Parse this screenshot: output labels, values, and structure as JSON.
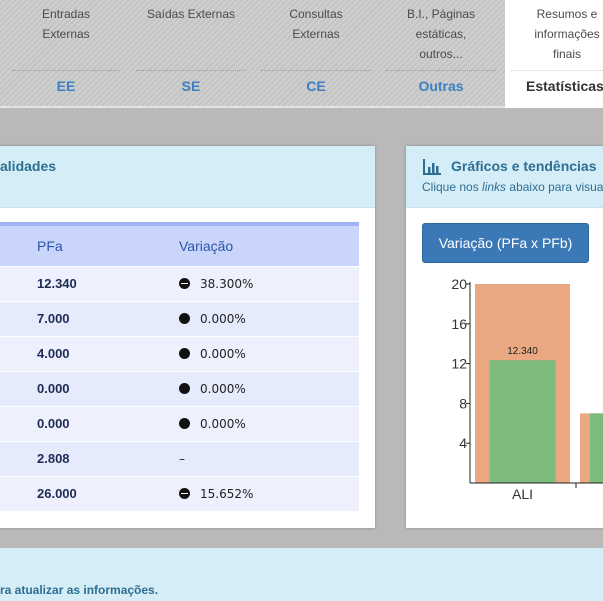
{
  "tabs": [
    {
      "description": [
        "Entradas",
        "Externas"
      ],
      "code": "EE"
    },
    {
      "description": [
        "Saídas Externas"
      ],
      "code": "SE"
    },
    {
      "description": [
        "Consultas",
        "Externas"
      ],
      "code": "CE"
    },
    {
      "description": [
        "B.I., Páginas",
        "estáticas,",
        "outros..."
      ],
      "code": "Outras"
    },
    {
      "description": [
        "Resumos e",
        "informações",
        "finais"
      ],
      "code": "Estatísticas",
      "active": true
    }
  ],
  "left_panel": {
    "title": "alidades",
    "columns": [
      "PFa",
      "Variação"
    ],
    "rows": [
      {
        "pfa": "12.340",
        "variation": "38.300%",
        "mark": "minus"
      },
      {
        "pfa": "7.000",
        "variation": "0.000%",
        "mark": "dot"
      },
      {
        "pfa": "4.000",
        "variation": "0.000%",
        "mark": "dot"
      },
      {
        "pfa": "0.000",
        "variation": "0.000%",
        "mark": "dot"
      },
      {
        "pfa": "0.000",
        "variation": "0.000%",
        "mark": "dot"
      },
      {
        "pfa": "2.808",
        "variation": "–",
        "mark": "none"
      },
      {
        "pfa": "26.000",
        "variation": "15.652%",
        "mark": "minus"
      }
    ]
  },
  "right_panel": {
    "title": "Gráficos e tendências",
    "subtitle_before": "Clique nos ",
    "subtitle_em": "links",
    "subtitle_after": " abaixo para visua",
    "button_label": "Variação (PFa x PFb)"
  },
  "chart_data": {
    "type": "bar",
    "categories": [
      "ALI",
      ""
    ],
    "series": [
      {
        "values": [
          20,
          7
        ],
        "color": "#eaa882"
      },
      {
        "values": [
          12.34,
          7
        ],
        "color": "#7cbb7c"
      }
    ],
    "ylim": [
      0,
      20
    ],
    "yticks": [
      4,
      8,
      12,
      16,
      20
    ],
    "data_labels": [
      "12.340"
    ]
  },
  "footer": {
    "text": "ra atualizar as informações."
  }
}
